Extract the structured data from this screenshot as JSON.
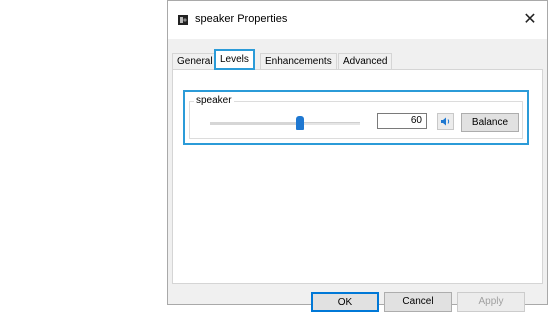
{
  "window": {
    "title": "speaker Properties",
    "close_label": "✕"
  },
  "tabs": [
    {
      "label": "General",
      "active": false
    },
    {
      "label": "Levels",
      "active": true
    },
    {
      "label": "Enhancements",
      "active": false
    },
    {
      "label": "Advanced",
      "active": false
    }
  ],
  "levels": {
    "group_label": "speaker",
    "volume_value": "60",
    "slider_fraction": 0.6,
    "balance_label": "Balance"
  },
  "footer": {
    "ok_label": "OK",
    "cancel_label": "Cancel",
    "apply_label": "Apply"
  },
  "colors": {
    "accent": "#2b9bd8",
    "slider_thumb": "#1f78d1"
  },
  "icons": {
    "title_icon": "speaker-device-icon",
    "mute_icon": "speaker-volume-icon"
  }
}
